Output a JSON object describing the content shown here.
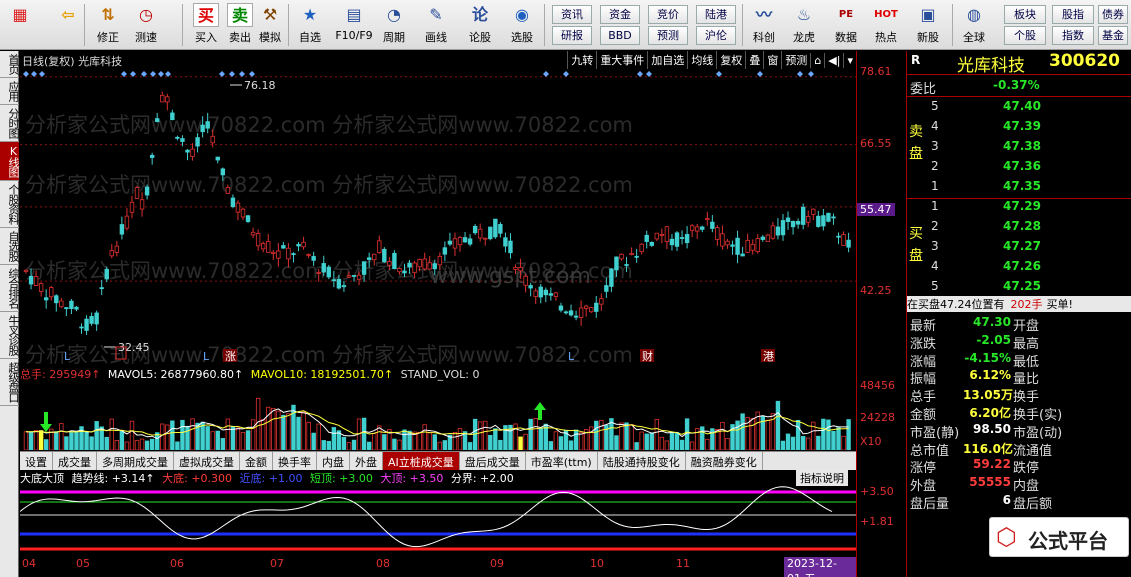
{
  "toolbar": {
    "items": [
      {
        "label": "",
        "icon": "windows-icon"
      },
      {
        "label": "",
        "icon": "back-arrow-icon"
      },
      {
        "label": "修正",
        "icon": "revise-icon"
      },
      {
        "label": "测速",
        "icon": "clock-icon"
      },
      {
        "label": "买入",
        "icon": "buy-icon",
        "glyph": "买"
      },
      {
        "label": "卖出",
        "icon": "sell-icon",
        "glyph": "卖"
      },
      {
        "label": "模拟",
        "icon": "hammer-icon"
      },
      {
        "label": "自选",
        "icon": "star-icon"
      },
      {
        "label": "F10/F9",
        "icon": "f10-icon"
      },
      {
        "label": "周期",
        "icon": "period-icon"
      },
      {
        "label": "画线",
        "icon": "pencil-icon"
      },
      {
        "label": "论股",
        "icon": "discuss-icon"
      },
      {
        "label": "选股",
        "icon": "gauge-icon"
      },
      {
        "label": "科创",
        "icon": "kechuang-icon"
      },
      {
        "label": "龙虎",
        "icon": "dragon-icon"
      },
      {
        "label": "数据",
        "icon": "pe-icon",
        "glyph": "PE"
      },
      {
        "label": "热点",
        "icon": "fire-icon",
        "glyph": "HOT"
      },
      {
        "label": "新股",
        "icon": "newstock-icon"
      },
      {
        "label": "全球",
        "icon": "globe-icon"
      }
    ],
    "small_buttons": [
      "资讯",
      "资金",
      "竞价",
      "陆港",
      "研报",
      "BBD",
      "预测",
      "沪伦"
    ],
    "right_buttons": [
      "板块",
      "股指",
      "债券",
      "个股",
      "指数",
      "基金"
    ]
  },
  "left_tabs": [
    "首页",
    "应用",
    "分时图",
    "K线图",
    "个股资料",
    "自选股",
    "综合排名",
    "牛叉诊股",
    "超级盘口"
  ],
  "left_tabs_active": 3,
  "chart_header": {
    "title": "日线(复权) 光库科技",
    "tools": [
      "九转",
      "重大事件",
      "加自选",
      "均线",
      "复权",
      "叠",
      "窗",
      "预测"
    ]
  },
  "price_scale": [
    "78.61",
    "66.55",
    "55.47",
    "42.25"
  ],
  "price_scale_highlight": "55.47",
  "price_annotations": {
    "high": "76.18",
    "low": "32.45"
  },
  "event_markers": [
    {
      "text": "L",
      "type": "letter"
    },
    {
      "text": "L",
      "type": "letter"
    },
    {
      "text": "涨",
      "type": "boxed"
    },
    {
      "text": "L",
      "type": "letter"
    },
    {
      "text": "财",
      "type": "boxed"
    },
    {
      "text": "港",
      "type": "boxed"
    }
  ],
  "watermark": {
    "line1": "分析家公式网www.70822.com",
    "center": "www.gspt.com"
  },
  "volume_header": {
    "total_label": "总手: ",
    "total_value": "295949↑",
    "ma5": "MAVOL5: 26877960.80↑",
    "ma10": "MAVOL10: 18192501.70↑",
    "std": "STAND_VOL: 0"
  },
  "volume_scale": [
    "48456",
    "24228",
    "X10"
  ],
  "indicator_tabs": [
    "设置",
    "成交量",
    "多周期成交量",
    "虚拟成交量",
    "金额",
    "换手率",
    "内盘",
    "外盘",
    "AI立桩成交量",
    "盘后成交量",
    "市盈率(ttm)",
    "陆股通持股变化",
    "融资融券变化"
  ],
  "indicator_tabs_active": 8,
  "indicator_header": {
    "name": "大底大顶",
    "trend": "趋势线: +3.14↑",
    "bottom": "大底: +0.300",
    "near_bottom": "近底: +1.00",
    "short_top": "短顶: +3.00",
    "top": "大顶: +3.50",
    "divide": "分界: +2.00",
    "explain": "指标说明"
  },
  "indicator_scale": [
    "+3.50",
    "+1.81"
  ],
  "time_axis": [
    "04",
    "05",
    "06",
    "07",
    "08",
    "09",
    "10",
    "11"
  ],
  "time_cursor": "2023-12-01,五",
  "quote": {
    "name": "光库科技",
    "code": "300620",
    "weibi_label": "委比",
    "weibi_value": "-0.37%",
    "sell_label": "卖盘",
    "buy_label": "买盘",
    "sell": [
      {
        "lvl": "5",
        "price": "47.40"
      },
      {
        "lvl": "4",
        "price": "47.39"
      },
      {
        "lvl": "3",
        "price": "47.38"
      },
      {
        "lvl": "2",
        "price": "47.36"
      },
      {
        "lvl": "1",
        "price": "47.35"
      }
    ],
    "buy": [
      {
        "lvl": "1",
        "price": "47.29"
      },
      {
        "lvl": "2",
        "price": "47.28"
      },
      {
        "lvl": "3",
        "price": "47.27"
      },
      {
        "lvl": "4",
        "price": "47.26"
      },
      {
        "lvl": "5",
        "price": "47.25"
      }
    ],
    "pos_note": "在买盘47.24位置有",
    "pos_qty": "202手",
    "pos_action": "买单!",
    "stats": [
      {
        "l": "最新",
        "v": "47.30",
        "vc": "green",
        "r": "开盘",
        "rv": ""
      },
      {
        "l": "涨跌",
        "v": "-2.05",
        "vc": "green",
        "r": "最高",
        "rv": ""
      },
      {
        "l": "涨幅",
        "v": "-4.15%",
        "vc": "green",
        "r": "最低",
        "rv": ""
      },
      {
        "l": "振幅",
        "v": "6.12%",
        "vc": "yellow",
        "r": "量比",
        "rv": ""
      },
      {
        "l": "总手",
        "v": "13.05万",
        "vc": "yellow",
        "r": "换手",
        "rv": ""
      },
      {
        "l": "金额",
        "v": "6.20亿",
        "vc": "yellow",
        "r": "换手(实)",
        "rv": ""
      },
      {
        "l": "市盈(静)",
        "v": "98.50",
        "vc": "white",
        "r": "市盈(动)",
        "rv": ""
      },
      {
        "l": "总市值",
        "v": "116.0亿",
        "vc": "yellow",
        "r": "流通值",
        "rv": ""
      },
      {
        "l": "涨停",
        "v": "59.22",
        "vc": "red",
        "r": "跌停",
        "rv": ""
      },
      {
        "l": "外盘",
        "v": "55555",
        "vc": "red",
        "r": "内盘",
        "rv": ""
      },
      {
        "l": "盘后量",
        "v": "6",
        "vc": "white",
        "r": "盘后额",
        "rv": ""
      }
    ],
    "r_label": "R"
  },
  "brand_badge": "公式平台",
  "colors": {
    "up": "#e03030",
    "down": "#40d0d0",
    "accent": "#a00000",
    "green": "#28e628",
    "magenta": "#ff00ff",
    "blue": "#2030ff"
  }
}
